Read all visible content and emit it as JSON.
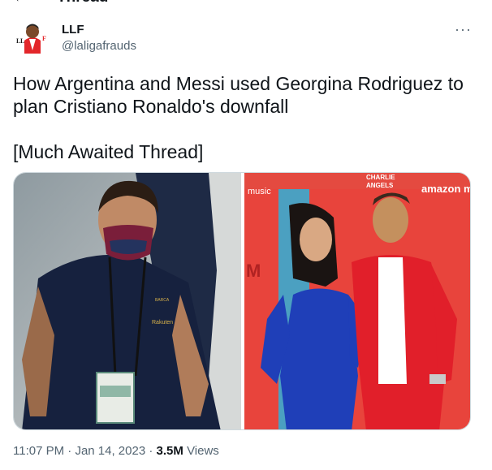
{
  "header": {
    "title": "Thread",
    "back_icon": "arrow-left-icon"
  },
  "author": {
    "name": "LLF",
    "handle": "@laligafrauds",
    "avatar_text": "LL F"
  },
  "tweet": {
    "text": "How Argentina and Messi used Georgina Rodriguez to plan Cristiano Ronaldo's downfall\n\n[Much Awaited Thread]"
  },
  "media": {
    "left_photo_text": {
      "brand": "Rakuten",
      "club": "BARCA"
    },
    "right_photo_text": {
      "music": "music",
      "amazon": "amazon m",
      "charlie": "CHARLIE",
      "angels": "ANGELS"
    }
  },
  "meta": {
    "time": "11:07 PM",
    "date": "Jan 14, 2023",
    "views_count": "3.5M",
    "views_label": "Views"
  },
  "colors": {
    "text": "#0f1419",
    "secondary": "#536471",
    "red_backdrop": "#e8443c",
    "blue_dress": "#1f3fb8",
    "red_suit": "#e11f2a"
  }
}
